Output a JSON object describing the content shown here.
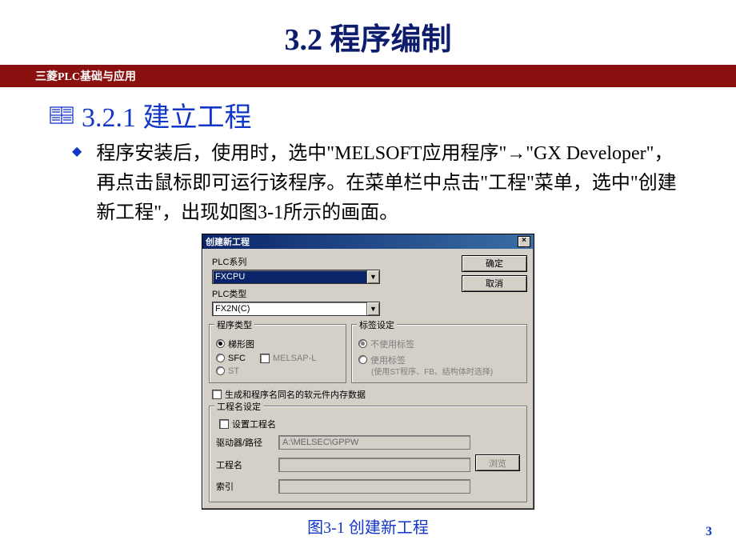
{
  "slide": {
    "title": "3.2   程序编制",
    "band": "三菱PLC基础与应用",
    "section": "3.2.1  建立工程",
    "body": "程序安装后，使用时，选中\"MELSOFT应用程序\"→\"GX Developer\"，再点击鼠标即可运行该程序。在菜单栏中点击\"工程\"菜单，选中\"创建新工程\"，出现如图3-1所示的画面。",
    "caption": "图3-1  创建新工程",
    "page": "3"
  },
  "dialog": {
    "title": "创建新工程",
    "ok": "确定",
    "cancel": "取消",
    "plc_series_label": "PLC系列",
    "plc_series_value": "FXCPU",
    "plc_type_label": "PLC类型",
    "plc_type_value": "FX2N(C)",
    "prog_type_group": "程序类型",
    "radio_ladder": "梯形图",
    "radio_sfc": "SFC",
    "chk_melsap": "MELSAP-L",
    "radio_st": "ST",
    "label_group": "标签设定",
    "radio_nolabel": "不使用标签",
    "radio_uselabel": "使用标签",
    "uselabel_note": "(使用ST程序、FB、结构体时选择)",
    "gen_mem": "生成和程序名同名的软元件内存数据",
    "proj_group": "工程名设定",
    "set_name": "设置工程名",
    "drive_label": "驱动器/路径",
    "drive_value": "A:\\MELSEC\\GPPW",
    "proj_label": "工程名",
    "browse": "浏览",
    "index_label": "索引"
  }
}
